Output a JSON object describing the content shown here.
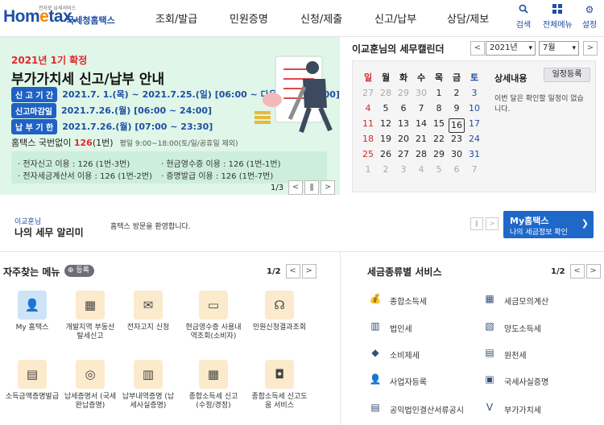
{
  "header": {
    "logo_tagline": "전자로 납세서비스",
    "logo_word_a": "Hom",
    "logo_word_e": "e",
    "logo_word_b": "tax.",
    "logo_kr": "국세청홈택스",
    "nav": [
      "조회/발급",
      "민원증명",
      "신청/제출",
      "신고/납부",
      "상담/제보"
    ],
    "search_label": "검색",
    "menu_label": "전체메뉴",
    "settings_label": "설정"
  },
  "banner": {
    "year_title": "2021년 1기 확정",
    "main_title": "부가가치세 신고/납부 안내",
    "periods": [
      {
        "label": "신 고 기 간",
        "value": "2021.7. 1.(목) ~ 2021.7.25.(일) [06:00 ~ 다음날 새벽 01:00]"
      },
      {
        "label": "신고마감일",
        "value": "2021.7.26.(월) [06:00 ~ 24:00]"
      },
      {
        "label": "납 부 기 한",
        "value": "2021.7.26.(월) [07:00 ~ 23:30]"
      }
    ],
    "phone_prefix": "홈택스 국번없이 ",
    "phone_number": "126",
    "phone_suffix": "(1번)",
    "phone_hours": "평일 9:00~18:00(토/일/공휴일 제외)",
    "usage": [
      "· 전자신고 이용 : 126 (1번-3번)",
      "· 현금영수증 이용 : 126 (1번-1번)",
      "· 전자세금계산서 이용 : 126 (1번-2번)",
      "· 증명발급 이용 : 126 (1번-7번)"
    ],
    "page": "1/3"
  },
  "calendar": {
    "title": "이교훈님의 세무캘린더",
    "year_select": "2021년",
    "month_select": "7월",
    "weekdays": [
      "일",
      "월",
      "화",
      "수",
      "목",
      "금",
      "토"
    ],
    "weeks": [
      [
        "27",
        "28",
        "29",
        "30",
        "1",
        "2",
        "3"
      ],
      [
        "4",
        "5",
        "6",
        "7",
        "8",
        "9",
        "10"
      ],
      [
        "11",
        "12",
        "13",
        "14",
        "15",
        "16",
        "17"
      ],
      [
        "18",
        "19",
        "20",
        "21",
        "22",
        "23",
        "24"
      ],
      [
        "25",
        "26",
        "27",
        "28",
        "29",
        "30",
        "31"
      ],
      [
        "1",
        "2",
        "3",
        "4",
        "5",
        "6",
        "7"
      ]
    ],
    "today": "16",
    "detail_title": "상세내용",
    "add_button": "일정등록",
    "empty_message": "이번 달은 확인할 일정이 없습니다."
  },
  "notice": {
    "user": "이교훈님",
    "heading": "나의 세무 알리미",
    "message": "홈택스 방문을 환영합니다.",
    "my_title": "My홈택스",
    "my_sub": "나의 세금정보 확인"
  },
  "favorites": {
    "title": "자주찾는 메뉴",
    "register": "등록",
    "page": "1/2",
    "items": [
      {
        "label": "My 홈택스",
        "icon": "user-icon"
      },
      {
        "label": "개발지역 부동산 탈세신고",
        "icon": "building-report-icon"
      },
      {
        "label": "전자고지 신청",
        "icon": "notice-icon"
      },
      {
        "label": "현금영수증 사용내역조회(소비자)",
        "icon": "receipt-icon"
      },
      {
        "label": "민원신청결과조회",
        "icon": "headset-icon"
      },
      {
        "label": "소득금액증명발급",
        "icon": "certificate-icon"
      },
      {
        "label": "납세증명서 (국세완납증명)",
        "icon": "certificate-search-icon"
      },
      {
        "label": "납부내역증명 (납세사실증명)",
        "icon": "document-icon"
      },
      {
        "label": "종합소득세 신고(수정/경정)",
        "icon": "calendar-icon"
      },
      {
        "label": "종합소득세 신고도움 서비스",
        "icon": "help-doc-icon"
      }
    ]
  },
  "tax_services": {
    "title": "세금종류별 서비스",
    "page": "1/2",
    "items": [
      {
        "label": "종합소득세",
        "icon": "money-bag-icon"
      },
      {
        "label": "세금모의계산",
        "icon": "calculator-icon"
      },
      {
        "label": "법인세",
        "icon": "office-icon"
      },
      {
        "label": "양도소득세",
        "icon": "transfer-icon"
      },
      {
        "label": "소비제세",
        "icon": "diamond-icon"
      },
      {
        "label": "원천세",
        "icon": "withholding-icon"
      },
      {
        "label": "사업자등록",
        "icon": "register-user-icon"
      },
      {
        "label": "국세사실증명",
        "icon": "certify-icon"
      },
      {
        "label": "공익법인결산서류공시",
        "icon": "disclosure-icon"
      },
      {
        "label": "부가가치세",
        "icon": "vat-icon"
      }
    ]
  }
}
